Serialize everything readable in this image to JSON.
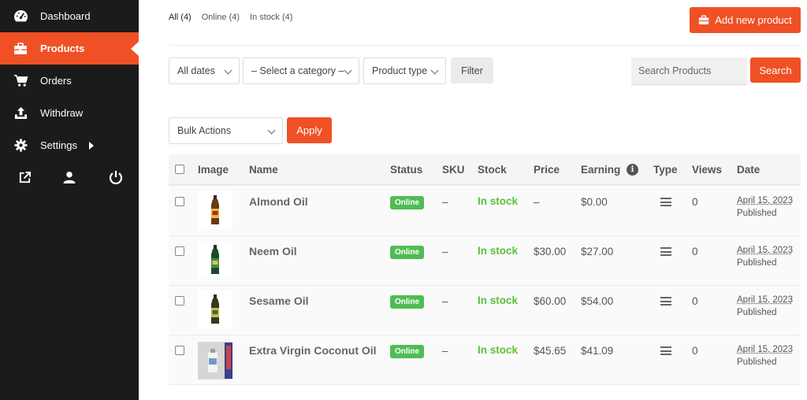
{
  "sidebar": {
    "items": [
      {
        "label": "Dashboard",
        "icon": "dashboard-icon"
      },
      {
        "label": "Products",
        "icon": "briefcase-icon"
      },
      {
        "label": "Orders",
        "icon": "cart-icon"
      },
      {
        "label": "Withdraw",
        "icon": "upload-icon"
      },
      {
        "label": "Settings",
        "icon": "gear-icon"
      }
    ],
    "footer_icons": [
      "external-link-icon",
      "user-icon",
      "power-icon"
    ]
  },
  "header": {
    "filters": [
      {
        "label": "All (4)"
      },
      {
        "label": "Online (4)"
      },
      {
        "label": "In stock (4)"
      }
    ],
    "add_button": "Add new product"
  },
  "toolbar": {
    "dates": "All dates",
    "category": "– Select a category –",
    "type": "Product type",
    "filter_button": "Filter",
    "search_placeholder": "Search Products",
    "search_button": "Search",
    "bulk_actions": "Bulk Actions",
    "apply_button": "Apply"
  },
  "table": {
    "columns": {
      "image": "Image",
      "name": "Name",
      "status": "Status",
      "sku": "SKU",
      "stock": "Stock",
      "price": "Price",
      "earning": "Earning",
      "type": "Type",
      "views": "Views",
      "date": "Date"
    },
    "rows": [
      {
        "name": "Almond Oil",
        "status": "Online",
        "sku": "–",
        "stock": "In stock",
        "price": "–",
        "earning": "$0.00",
        "views": "0",
        "date": "April 15, 2023",
        "state": "Published"
      },
      {
        "name": "Neem Oil",
        "status": "Online",
        "sku": "–",
        "stock": "In stock",
        "price": "$30.00",
        "earning": "$27.00",
        "views": "0",
        "date": "April 15, 2023",
        "state": "Published"
      },
      {
        "name": "Sesame Oil",
        "status": "Online",
        "sku": "–",
        "stock": "In stock",
        "price": "$60.00",
        "earning": "$54.00",
        "views": "0",
        "date": "April 15, 2023",
        "state": "Published"
      },
      {
        "name": "Extra Virgin Coconut Oil",
        "status": "Online",
        "sku": "–",
        "stock": "In stock",
        "price": "$45.65",
        "earning": "$41.09",
        "views": "0",
        "date": "April 15, 2023",
        "state": "Published"
      }
    ]
  },
  "colors": {
    "accent": "#f05025",
    "sidebar": "#1b1b1b",
    "online": "#4fbd53",
    "in_stock": "#5bc236"
  }
}
